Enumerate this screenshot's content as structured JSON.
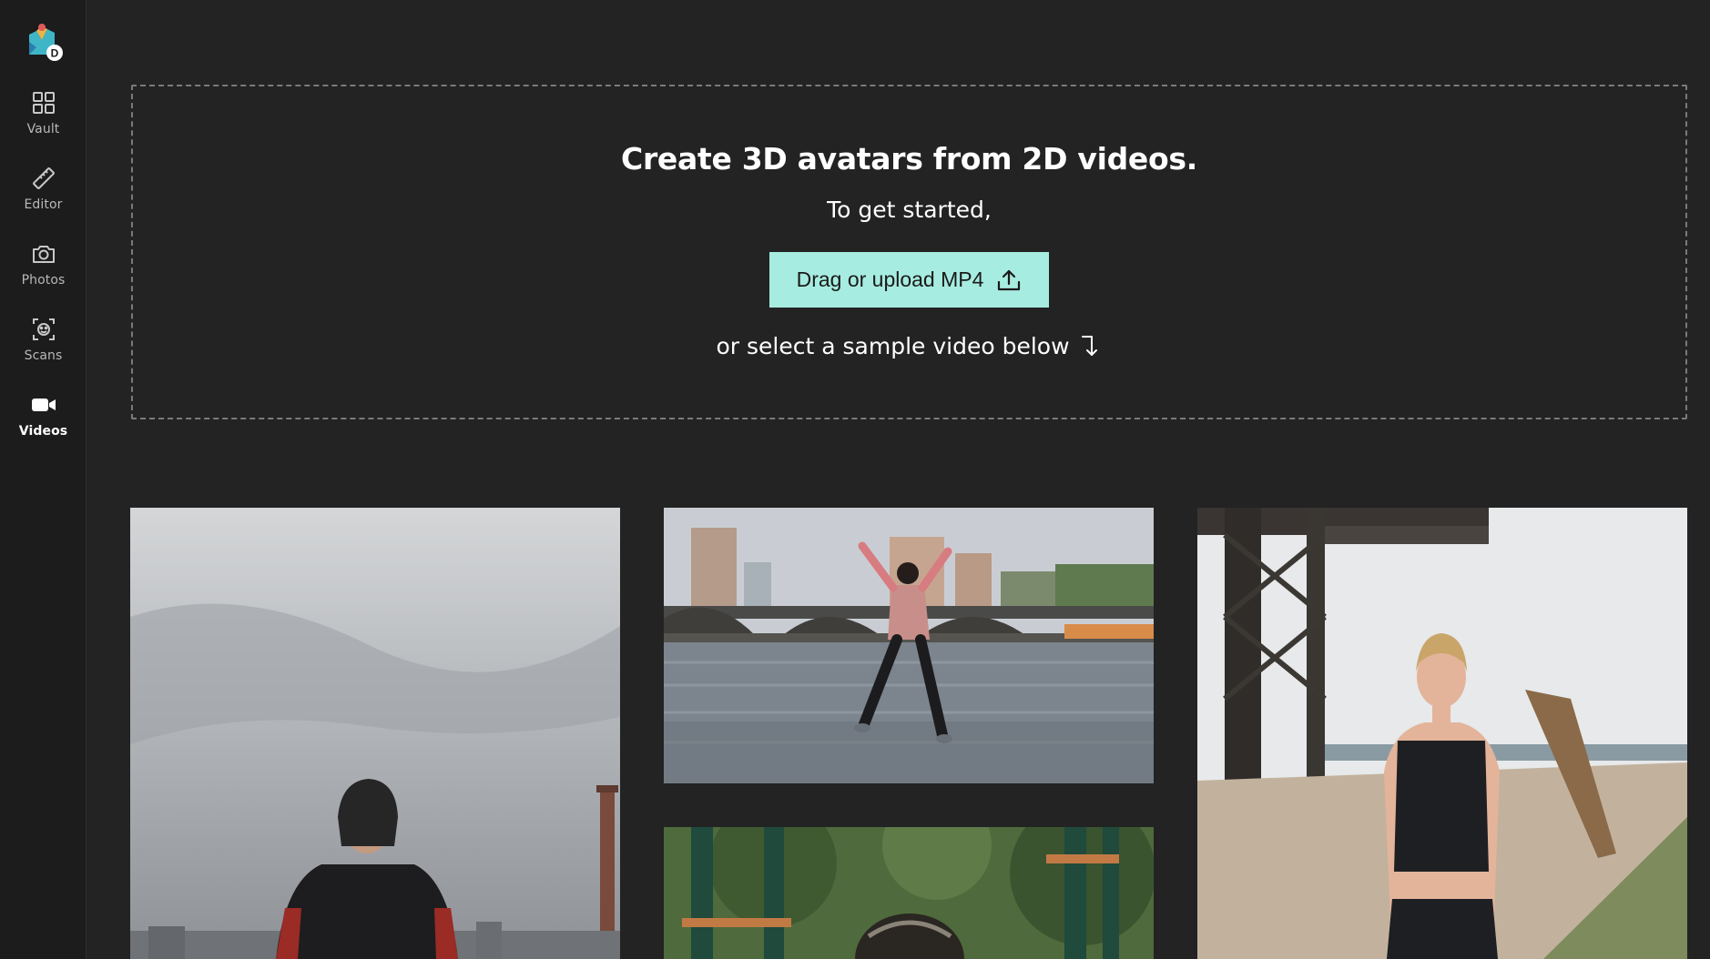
{
  "sidebar": {
    "logo_badge": "D",
    "items": [
      {
        "label": "Vault",
        "icon": "grid-icon"
      },
      {
        "label": "Editor",
        "icon": "ruler-icon"
      },
      {
        "label": "Photos",
        "icon": "camera-icon"
      },
      {
        "label": "Scans",
        "icon": "face-scan-icon"
      },
      {
        "label": "Videos",
        "icon": "video-camera-icon",
        "active": true
      }
    ]
  },
  "dropzone": {
    "headline": "Create 3D avatars from 2D videos.",
    "subline": "To get started,",
    "upload_label": "Drag or upload MP4",
    "sample_hint": "or select a sample video below"
  },
  "colors": {
    "background": "#232323",
    "sidebar": "#1c1c1c",
    "accent": "#a7ece0"
  },
  "samples": [
    {
      "description": "man-in-hoodie"
    },
    {
      "description": "woman-jumping-by-river"
    },
    {
      "description": "woman-with-jump-rope"
    },
    {
      "description": "person-in-park"
    }
  ]
}
